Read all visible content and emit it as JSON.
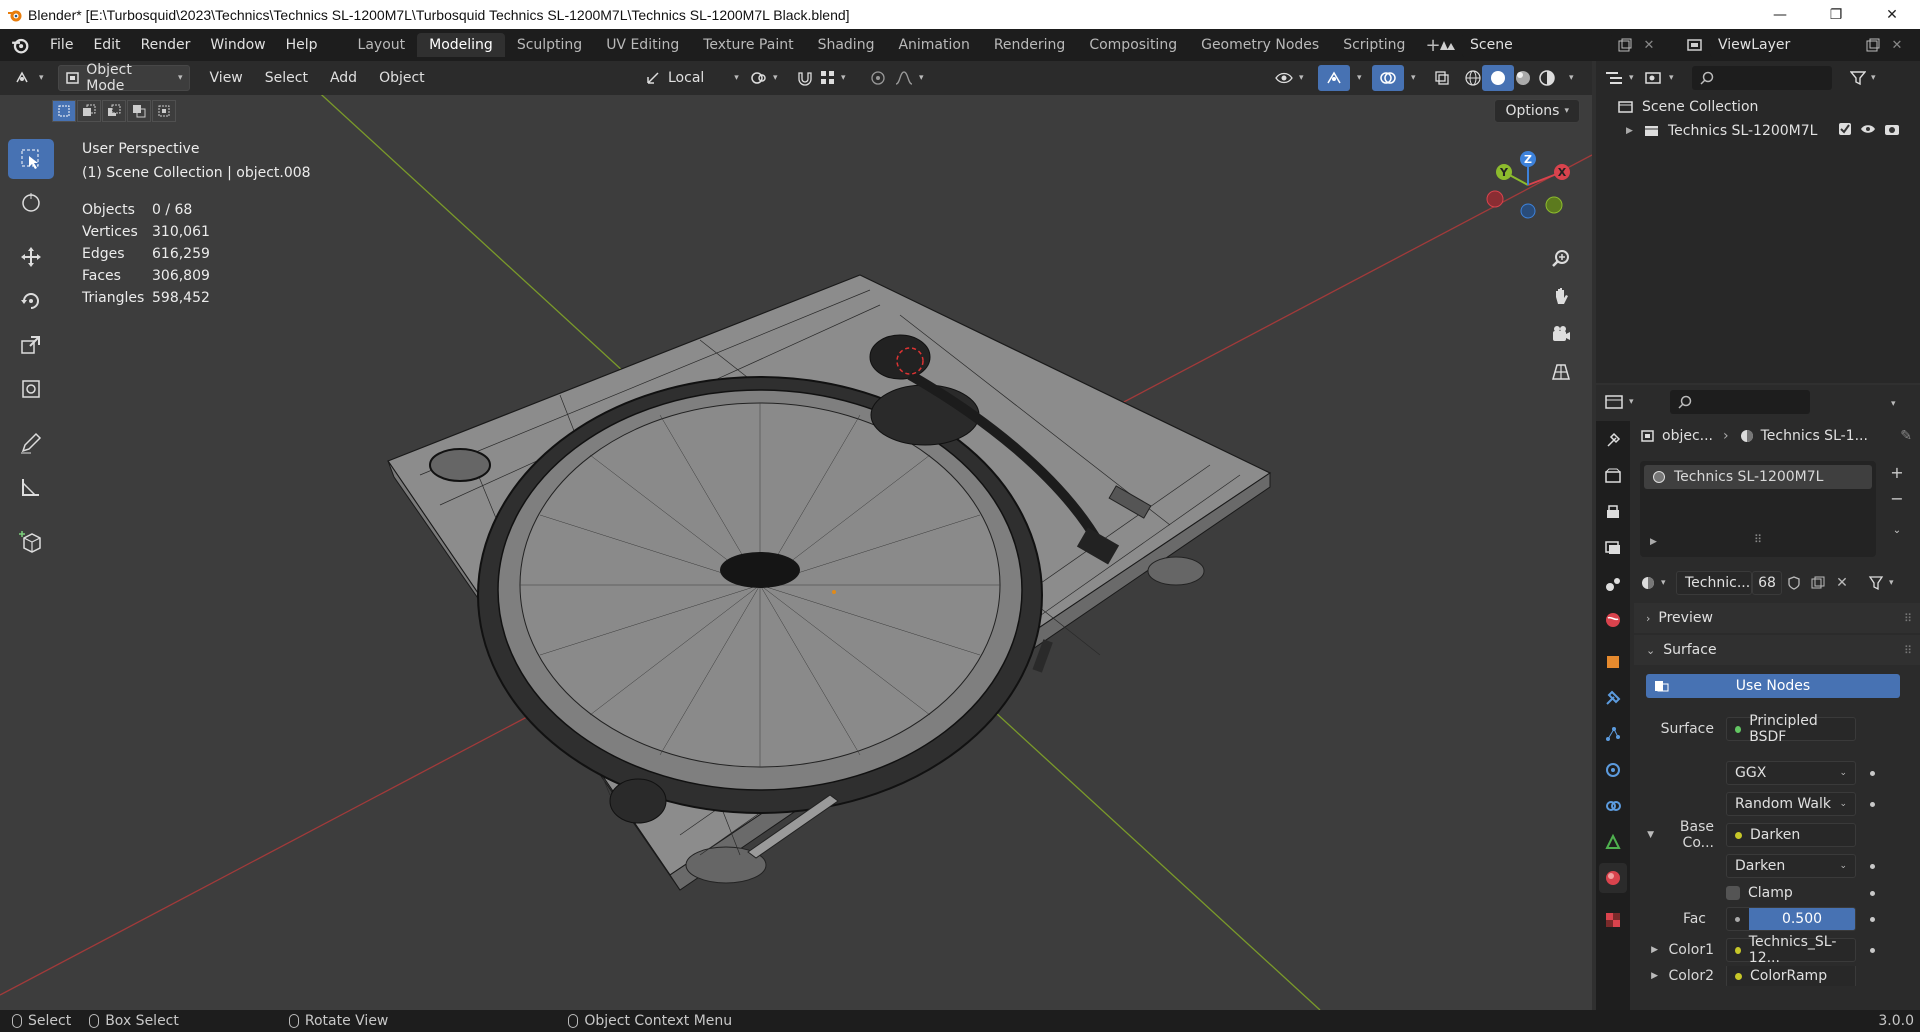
{
  "window": {
    "title": "Blender* [E:\\Turbosquid\\2023\\Technics\\Technics SL-1200M7L\\Turbosquid Technics SL-1200M7L\\Technics SL-1200M7L Black.blend]",
    "minimize": "—",
    "maximize": "❐",
    "close": "✕"
  },
  "menu": [
    "File",
    "Edit",
    "Render",
    "Window",
    "Help"
  ],
  "workspaces": [
    "Layout",
    "Modeling",
    "Sculpting",
    "UV Editing",
    "Texture Paint",
    "Shading",
    "Animation",
    "Rendering",
    "Compositing",
    "Geometry Nodes",
    "Scripting"
  ],
  "active_workspace": "Modeling",
  "scene": {
    "name": "Scene",
    "view_layer": "ViewLayer"
  },
  "viewport_header": {
    "mode": "Object Mode",
    "menus": [
      "View",
      "Select",
      "Add",
      "Object"
    ],
    "transform_orientation": "Local",
    "options": "Options"
  },
  "viewport": {
    "perspective": "User Perspective",
    "collection_info": "(1) Scene Collection | object.008",
    "stats": [
      {
        "label": "Objects",
        "value": "0 / 68"
      },
      {
        "label": "Vertices",
        "value": "310,061"
      },
      {
        "label": "Edges",
        "value": "616,259"
      },
      {
        "label": "Faces",
        "value": "306,809"
      },
      {
        "label": "Triangles",
        "value": "598,452"
      }
    ],
    "gizmo_axes": [
      "X",
      "Y",
      "Z"
    ]
  },
  "outliner": {
    "root": "Scene Collection",
    "items": [
      "Technics SL-1200M7L"
    ]
  },
  "properties": {
    "breadcrumb": [
      "objec...",
      "Technics SL-1..."
    ],
    "material_slot": "Technics SL-1200M7L",
    "material_name": "Technic...",
    "user_count": "68",
    "panels": {
      "preview": "Preview",
      "surface": "Surface"
    },
    "use_nodes": "Use Nodes",
    "surface_label": "Surface",
    "surface_value": "Principled BSDF",
    "distribution": "GGX",
    "subsurface": "Random Walk",
    "base_color_label": "Base Co...",
    "base_color_value": "Darken",
    "blend_mode": "Darken",
    "clamp": "Clamp",
    "fac_label": "Fac",
    "fac_value": "0.500",
    "fac": 0.5,
    "color1_label": "Color1",
    "color1_value": "Technics_SL-12...",
    "color2_label": "Color2",
    "color2_value": "ColorRamp"
  },
  "statusbar": {
    "items": [
      "Select",
      "Box Select",
      "Rotate View",
      "Object Context Menu"
    ],
    "version": "3.0.0"
  },
  "colors": {
    "accent": "#4772b3",
    "x_axis": "#d9434d",
    "y_axis": "#8cbb2d",
    "z_axis": "#3d82db"
  }
}
